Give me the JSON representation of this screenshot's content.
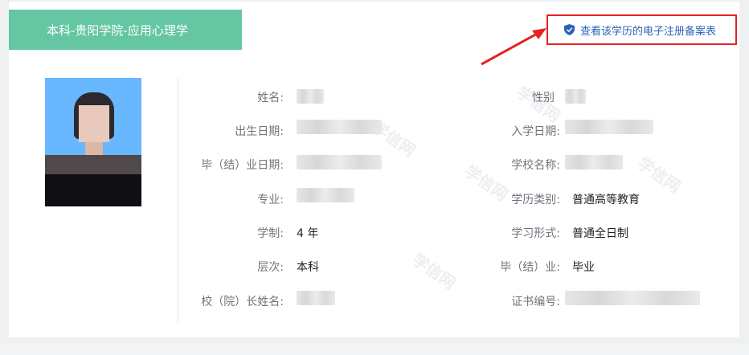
{
  "header": {
    "title": "本科-贵阳学院-应用心理学"
  },
  "link": {
    "label": "查看该学历的电子注册备案表",
    "icon": "shield-check-icon",
    "highlight_color": "#e62222",
    "link_color": "#2d62b9"
  },
  "accent_color": "#64c6a2",
  "watermark_text": "学信网",
  "left_fields": [
    {
      "label": "姓名:",
      "value": ""
    },
    {
      "label": "出生日期:",
      "value": ""
    },
    {
      "label": "毕（结）业日期:",
      "value": ""
    },
    {
      "label": "专业:",
      "value": ""
    },
    {
      "label": "学制:",
      "value": "4 年"
    },
    {
      "label": "层次:",
      "value": "本科"
    },
    {
      "label": "校（院）长姓名:",
      "value": ""
    }
  ],
  "right_fields": [
    {
      "label": "性别",
      "value": ""
    },
    {
      "label": "入学日期:",
      "value": ""
    },
    {
      "label": "学校名称:",
      "value": ""
    },
    {
      "label": "学历类别:",
      "value": "普通高等教育"
    },
    {
      "label": "学习形式:",
      "value": "普通全日制"
    },
    {
      "label": "毕（结）业:",
      "value": "毕业"
    },
    {
      "label": "证书编号:",
      "value": ""
    }
  ]
}
